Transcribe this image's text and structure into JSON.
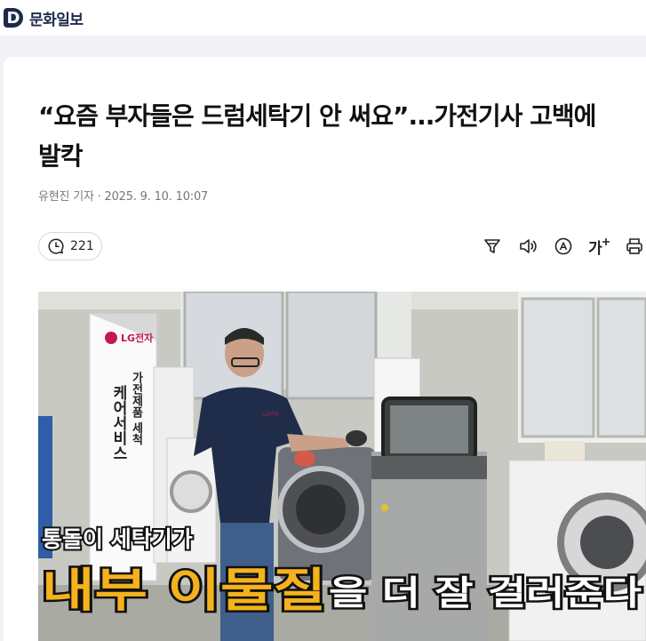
{
  "header": {
    "logo_letter": "D",
    "site_name": "문화일보"
  },
  "article": {
    "headline": "“요즘 부자들은 드럼세탁기 안 써요”...가전기사 고백에 발칵",
    "byline": "유현진 기자 · 2025. 9. 10. 10:07"
  },
  "actions": {
    "comment_count": "221",
    "font_size_label": "가"
  },
  "photo": {
    "banner_brand": "LG전자",
    "banner_col1": "케어서비스",
    "banner_col2": "가전제품 세척",
    "caption_small": "통돌이 세탁기가",
    "caption_highlight": "내부 이물질",
    "caption_rest": "을 더 잘 걸러준다",
    "shirt_logo": "LG전자"
  }
}
